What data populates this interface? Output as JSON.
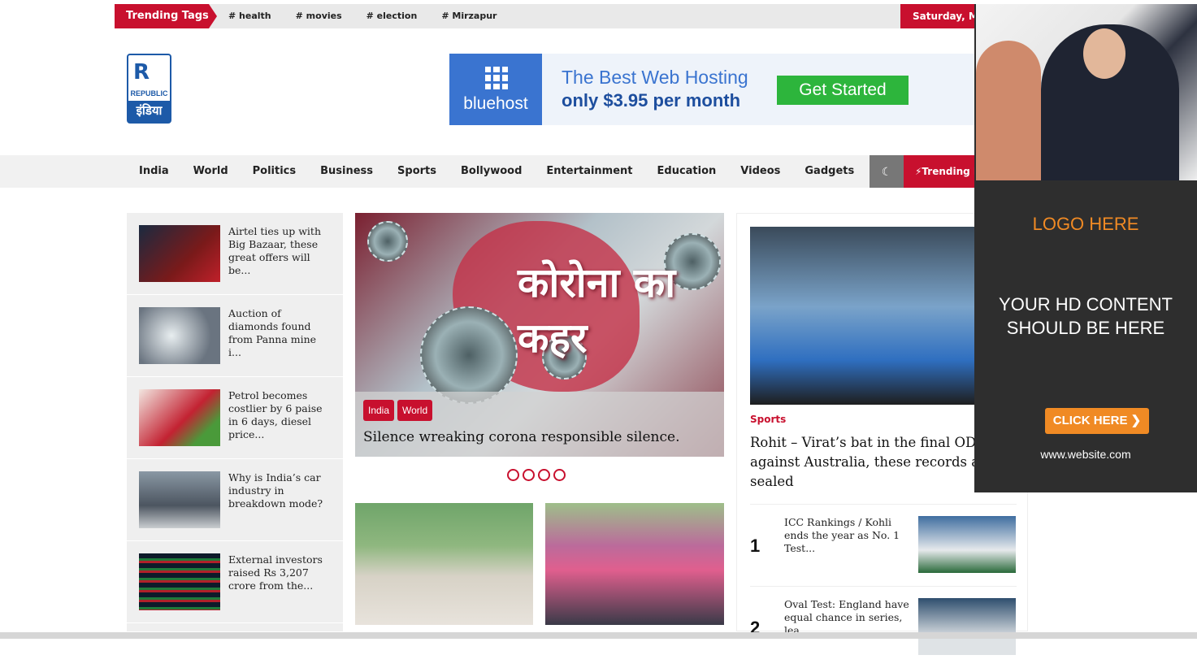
{
  "top_bar": {
    "trending_label": "Trending Tags",
    "tags": [
      "# health",
      "# movies",
      "# election",
      "# Mirzapur"
    ],
    "date": "Saturday, Ma"
  },
  "logo": {
    "mark": "R",
    "line1": "REPUBLIC",
    "line2": "इंडिया"
  },
  "banner": {
    "brand": "bluehost",
    "line1": "The Best Web Hosting",
    "line2": "only  $3.95  per month",
    "cta": "Get Started"
  },
  "nav": {
    "items": [
      "India",
      "World",
      "Politics",
      "Business",
      "Sports",
      "Bollywood",
      "Entertainment",
      "Education",
      "Videos",
      "Gadgets"
    ],
    "dark_icon": "☾",
    "trending": "⚡Trending N"
  },
  "left_list": [
    {
      "title": "Airtel ties up with Big Bazaar, these great offers will be...",
      "thumb_color": "#6b1a1a"
    },
    {
      "title": "Auction of diamonds found from Panna mine i...",
      "thumb_color": "#5a6068"
    },
    {
      "title": "Petrol becomes costlier by 6 paise in 6 days, diesel price...",
      "thumb_color": "#b02030"
    },
    {
      "title": "Why is India’s car industry in breakdown mode?",
      "thumb_color": "#596470"
    },
    {
      "title": "External investors raised Rs 3,207 crore from the...",
      "thumb_color": "#1b3a2a"
    }
  ],
  "slider": {
    "hindi_text": "कोरोना का कहर",
    "categories": [
      "India",
      "World"
    ],
    "headline": "Silence wreaking corona responsible silence.",
    "dot_count": 4
  },
  "right_card": {
    "category": "Sports",
    "title": "Rohit – Virat’s bat in the final ODI against Australia, these records are sealed",
    "items": [
      {
        "num": "1",
        "title": "ICC Rankings / Kohli ends the year as No. 1 Test...",
        "thumb_color": "#5b7a98"
      },
      {
        "num": "2",
        "title": "Oval Test: England have equal chance in series, lea...",
        "thumb_color": "#2f4a60"
      }
    ]
  },
  "ad": {
    "logo": "LOGO HERE",
    "content": "YOUR HD CONTENT SHOULD BE HERE",
    "button": "CLICK HERE ❯",
    "website": "www.website.com"
  }
}
